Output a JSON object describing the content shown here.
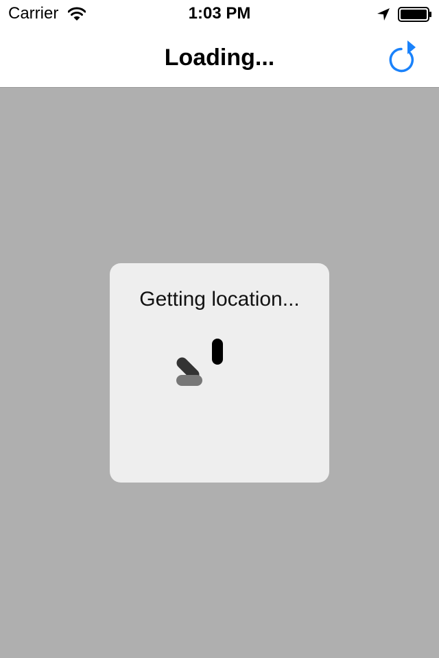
{
  "status_bar": {
    "carrier": "Carrier",
    "time": "1:03 PM",
    "icons": [
      "wifi-icon",
      "location-arrow-icon",
      "battery-icon"
    ]
  },
  "nav_bar": {
    "title": "Loading...",
    "right_button_icon": "refresh-icon"
  },
  "hud": {
    "message": "Getting location...",
    "spinner_icon": "activity-spinner-icon"
  },
  "colors": {
    "accent": "#1a82fb",
    "overlay": "#afafaf",
    "hud_background": "#eeeeee",
    "nav_background": "#ffffff"
  }
}
